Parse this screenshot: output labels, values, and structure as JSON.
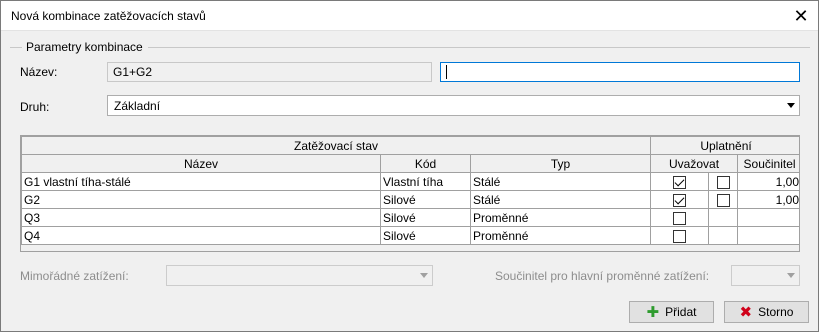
{
  "window": {
    "title": "Nová kombinace zatěžovacích stavů",
    "close_symbol": "✕"
  },
  "group": {
    "title": "Parametry kombinace"
  },
  "form": {
    "name_label": "Název:",
    "name_readonly_value": "G1+G2",
    "name_input_value": "",
    "type_label": "Druh:",
    "type_value": "Základní"
  },
  "table": {
    "group_headers": {
      "load_case": "Zatěžovací stav",
      "application": "Uplatnění"
    },
    "columns": {
      "name": "Název",
      "code": "Kód",
      "type": "Typ",
      "consider": "Uvažovat",
      "coefficient": "Součinitel"
    },
    "rows": [
      {
        "name": "G1 vlastní tíha-stálé",
        "code": "Vlastní tíha",
        "type": "Stálé",
        "consider": true,
        "secondary": false,
        "coefficient": "1,00"
      },
      {
        "name": "G2",
        "code": "Silové",
        "type": "Stálé",
        "consider": true,
        "secondary": false,
        "coefficient": "1,00"
      },
      {
        "name": "Q3",
        "code": "Silové",
        "type": "Proměnné",
        "consider": false,
        "coefficient": ""
      },
      {
        "name": "Q4",
        "code": "Silové",
        "type": "Proměnné",
        "consider": false,
        "coefficient": ""
      }
    ]
  },
  "bottom": {
    "accidental_label": "Mimořádné zatížení:",
    "accidental_value": "",
    "main_variable_label": "Součinitel pro hlavní proměnné zatížení:",
    "main_variable_value": ""
  },
  "buttons": {
    "add_label": "Přidat",
    "cancel_label": "Storno"
  },
  "icons": {
    "add": "plus-icon",
    "cancel": "x-icon",
    "close": "close-icon",
    "dropdown": "chevron-down-icon"
  },
  "colors": {
    "accent": "#0078d7",
    "add_icon": "#2e9b2e",
    "cancel_icon": "#d0021b"
  }
}
